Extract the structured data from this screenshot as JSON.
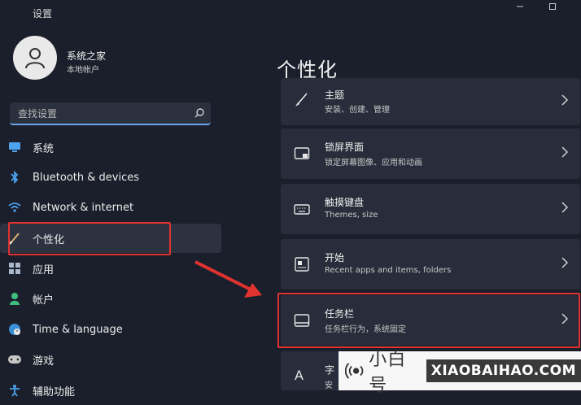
{
  "window": {
    "title": "设置"
  },
  "profile": {
    "name": "系统之家",
    "account_type": "本地帐户"
  },
  "search": {
    "placeholder": "查找设置"
  },
  "sidebar": {
    "items": [
      {
        "label": "系统",
        "icon": "monitor-icon"
      },
      {
        "label": "Bluetooth & devices",
        "icon": "bluetooth-icon"
      },
      {
        "label": "Network & internet",
        "icon": "wifi-icon"
      },
      {
        "label": "个性化",
        "icon": "brush-icon",
        "selected": true
      },
      {
        "label": "应用",
        "icon": "apps-grid-icon"
      },
      {
        "label": "帐户",
        "icon": "person-icon"
      },
      {
        "label": "Time & language",
        "icon": "globe-clock-icon"
      },
      {
        "label": "游戏",
        "icon": "gamepad-icon"
      },
      {
        "label": "辅助功能",
        "icon": "accessibility-icon"
      }
    ]
  },
  "main": {
    "title": "个性化",
    "cards": [
      {
        "title": "主题",
        "subtitle": "安装、创建、管理",
        "icon": "brush-icon"
      },
      {
        "title": "锁屏界面",
        "subtitle": "锁定屏幕图像、应用和动画",
        "icon": "lock-screen-icon"
      },
      {
        "title": "触摸键盘",
        "subtitle": "Themes, size",
        "icon": "keyboard-icon"
      },
      {
        "title": "开始",
        "subtitle": "Recent apps and items, folders",
        "icon": "start-menu-icon"
      },
      {
        "title": "任务栏",
        "subtitle": "任务栏行为，系统固定",
        "icon": "taskbar-icon"
      },
      {
        "title": "字",
        "subtitle": "安",
        "icon": "font-icon"
      }
    ]
  },
  "watermark": {
    "cn": "小白号",
    "en": "XIAOBAIHAO.COM"
  },
  "colors": {
    "accent": "#6aa6e8",
    "highlight": "#e0332f",
    "background": "#1a1f2b",
    "card": "#272d3a"
  }
}
